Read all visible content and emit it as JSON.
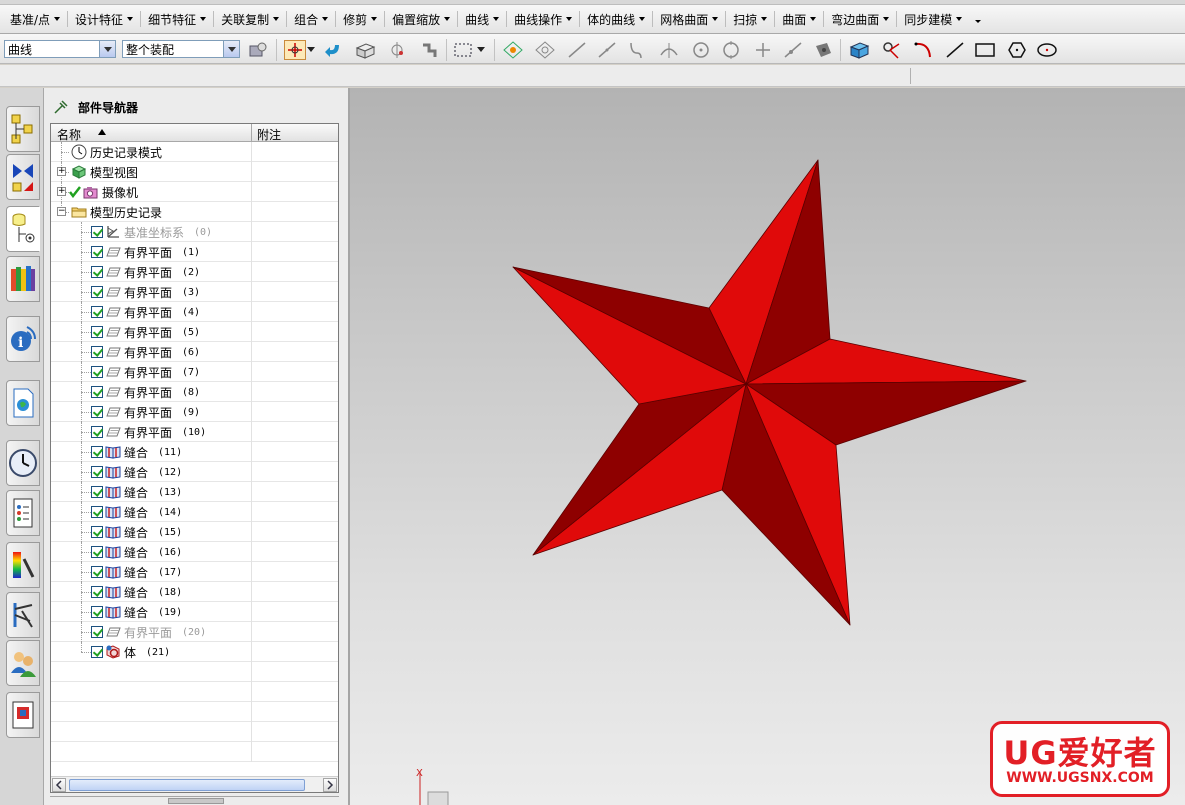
{
  "menubar": {
    "items": [
      "基准/点",
      "设计特征",
      "细节特征",
      "关联复制",
      "组合",
      "修剪",
      "偏置缩放",
      "曲线",
      "曲线操作",
      "体的曲线",
      "网格曲面",
      "扫掠",
      "曲面",
      "弯边曲面",
      "同步建模"
    ]
  },
  "toolbar": {
    "filter_combo": "曲线",
    "scope_combo": "整个装配"
  },
  "resource_bar": {
    "buttons": [
      "assembly-navigator-icon",
      "constraint-navigator-icon",
      "part-navigator-icon",
      "reuse-library-icon",
      "hd3d-tools-icon",
      "web-browser-icon",
      "history-icon",
      "process-studio-icon",
      "visualization-icon",
      "manufacturing-wizards-icon",
      "roles-icon",
      "system-materials-icon"
    ]
  },
  "navigator": {
    "title": "部件导航器",
    "col_name": "名称",
    "col_note": "附注",
    "nodes": [
      {
        "label": "历史记录模式",
        "num": "",
        "icon": "clock",
        "level": 0,
        "expander": "",
        "check": false,
        "dim": false
      },
      {
        "label": "模型视图",
        "num": "",
        "icon": "cube",
        "level": 0,
        "expander": "+",
        "check": false,
        "dim": false
      },
      {
        "label": "摄像机",
        "num": "",
        "icon": "camera",
        "level": 0,
        "expander": "+",
        "check": "green",
        "dim": false
      },
      {
        "label": "模型历史记录",
        "num": "",
        "icon": "folder",
        "level": 0,
        "expander": "-",
        "check": false,
        "dim": false
      },
      {
        "label": "基准坐标系",
        "num": "(0)",
        "icon": "csys",
        "level": 1,
        "expander": "",
        "check": true,
        "dim": true
      },
      {
        "label": "有界平面",
        "num": "(1)",
        "icon": "plane",
        "level": 1,
        "expander": "",
        "check": true,
        "dim": false
      },
      {
        "label": "有界平面",
        "num": "(2)",
        "icon": "plane",
        "level": 1,
        "expander": "",
        "check": true,
        "dim": false
      },
      {
        "label": "有界平面",
        "num": "(3)",
        "icon": "plane",
        "level": 1,
        "expander": "",
        "check": true,
        "dim": false
      },
      {
        "label": "有界平面",
        "num": "(4)",
        "icon": "plane",
        "level": 1,
        "expander": "",
        "check": true,
        "dim": false
      },
      {
        "label": "有界平面",
        "num": "(5)",
        "icon": "plane",
        "level": 1,
        "expander": "",
        "check": true,
        "dim": false
      },
      {
        "label": "有界平面",
        "num": "(6)",
        "icon": "plane",
        "level": 1,
        "expander": "",
        "check": true,
        "dim": false
      },
      {
        "label": "有界平面",
        "num": "(7)",
        "icon": "plane",
        "level": 1,
        "expander": "",
        "check": true,
        "dim": false
      },
      {
        "label": "有界平面",
        "num": "(8)",
        "icon": "plane",
        "level": 1,
        "expander": "",
        "check": true,
        "dim": false
      },
      {
        "label": "有界平面",
        "num": "(9)",
        "icon": "plane",
        "level": 1,
        "expander": "",
        "check": true,
        "dim": false
      },
      {
        "label": "有界平面",
        "num": "(10)",
        "icon": "plane",
        "level": 1,
        "expander": "",
        "check": true,
        "dim": false
      },
      {
        "label": "缝合",
        "num": "(11)",
        "icon": "sew",
        "level": 1,
        "expander": "",
        "check": true,
        "dim": false
      },
      {
        "label": "缝合",
        "num": "(12)",
        "icon": "sew",
        "level": 1,
        "expander": "",
        "check": true,
        "dim": false
      },
      {
        "label": "缝合",
        "num": "(13)",
        "icon": "sew",
        "level": 1,
        "expander": "",
        "check": true,
        "dim": false
      },
      {
        "label": "缝合",
        "num": "(14)",
        "icon": "sew",
        "level": 1,
        "expander": "",
        "check": true,
        "dim": false
      },
      {
        "label": "缝合",
        "num": "(15)",
        "icon": "sew",
        "level": 1,
        "expander": "",
        "check": true,
        "dim": false
      },
      {
        "label": "缝合",
        "num": "(16)",
        "icon": "sew",
        "level": 1,
        "expander": "",
        "check": true,
        "dim": false
      },
      {
        "label": "缝合",
        "num": "(17)",
        "icon": "sew",
        "level": 1,
        "expander": "",
        "check": true,
        "dim": false
      },
      {
        "label": "缝合",
        "num": "(18)",
        "icon": "sew",
        "level": 1,
        "expander": "",
        "check": true,
        "dim": false
      },
      {
        "label": "缝合",
        "num": "(19)",
        "icon": "sew",
        "level": 1,
        "expander": "",
        "check": true,
        "dim": false
      },
      {
        "label": "有界平面",
        "num": "(20)",
        "icon": "plane",
        "level": 1,
        "expander": "",
        "check": true,
        "dim": true
      },
      {
        "label": "体",
        "num": "(21)",
        "icon": "body",
        "level": 1,
        "expander": "",
        "check": true,
        "dim": false
      }
    ]
  },
  "graphics": {
    "triad_x_label": "X",
    "star_colors": {
      "light": "#e00a0a",
      "dark": "#8e0000",
      "edge": "#5a0000"
    }
  },
  "watermark": {
    "main": "UG爱好者",
    "url": "WWW.UGSNX.COM",
    "color": "#e21f26"
  }
}
